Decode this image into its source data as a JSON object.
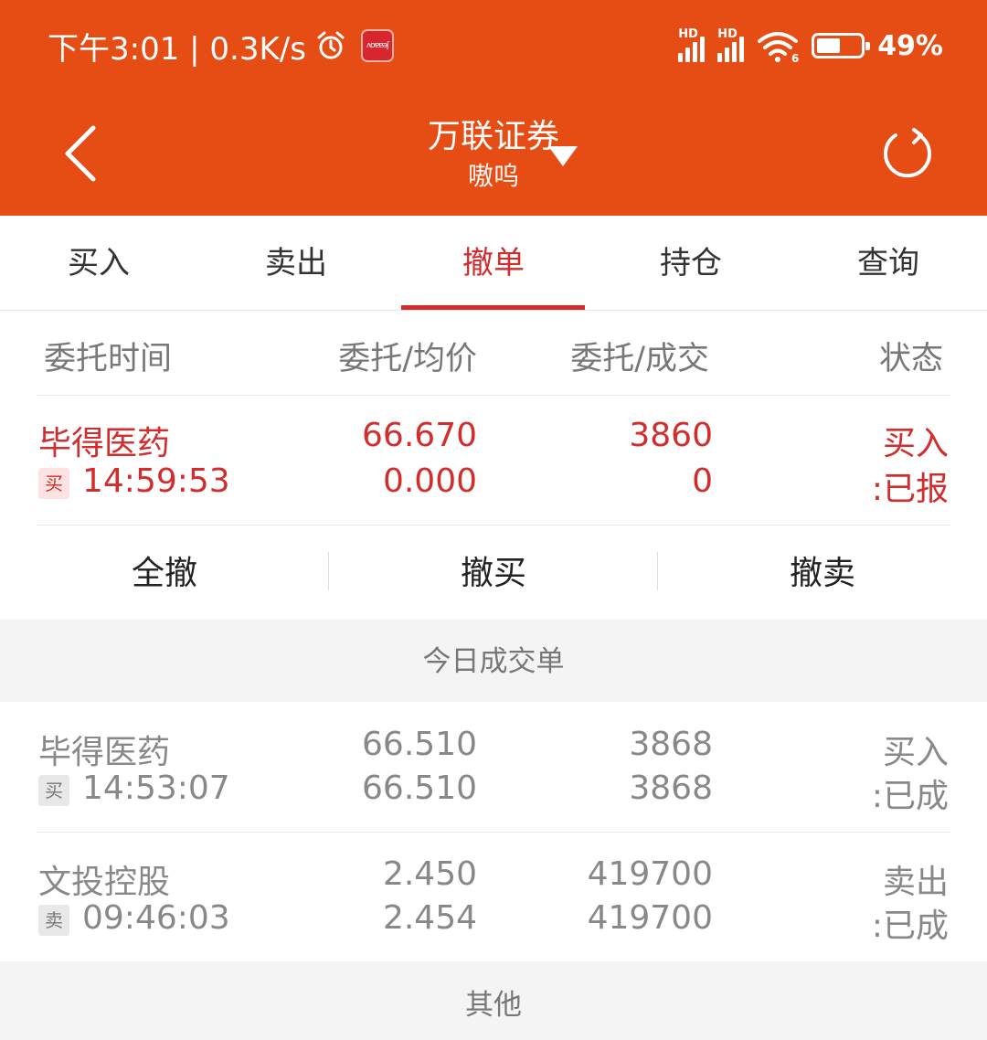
{
  "status_bar": {
    "time_speed": "下午3:01 | 0.3K/s",
    "badge_text": "ʌoɐɐǝʃ",
    "sim1": "HD",
    "sim2": "HD",
    "wifi_label": "6",
    "battery": "49%"
  },
  "header": {
    "title": "万联证券",
    "subtitle": "嗷呜"
  },
  "tabs": [
    {
      "label": "买入"
    },
    {
      "label": "卖出"
    },
    {
      "label": "撤单",
      "active": true
    },
    {
      "label": "持仓"
    },
    {
      "label": "查询"
    }
  ],
  "columns": [
    "委托时间",
    "委托/均价",
    "委托/成交",
    "状态"
  ],
  "pending_orders": [
    {
      "name": "毕得医药",
      "side": "买",
      "time": "14:59:53",
      "price": "66.670",
      "avg": "0.000",
      "qty": "3860",
      "filled": "0",
      "status1": "买入",
      "status2": ":已报"
    }
  ],
  "actions": [
    "全撤",
    "撤买",
    "撤卖"
  ],
  "today_section": "今日成交单",
  "today_trades": [
    {
      "name": "毕得医药",
      "side": "买",
      "time": "14:53:07",
      "price": "66.510",
      "avg": "66.510",
      "qty": "3868",
      "filled": "3868",
      "status1": "买入",
      "status2": ":已成"
    },
    {
      "name": "文投控股",
      "side": "卖",
      "time": "09:46:03",
      "price": "2.450",
      "avg": "2.454",
      "qty": "419700",
      "filled": "419700",
      "status1": "卖出",
      "status2": ":已成"
    }
  ],
  "other_section": "其他",
  "colors": {
    "brand": "#e54d15",
    "accent": "#d22c2c"
  },
  "icons": [
    "alarm-icon",
    "back-icon",
    "dropdown-icon",
    "refresh-icon",
    "wifi-icon",
    "battery-icon"
  ]
}
